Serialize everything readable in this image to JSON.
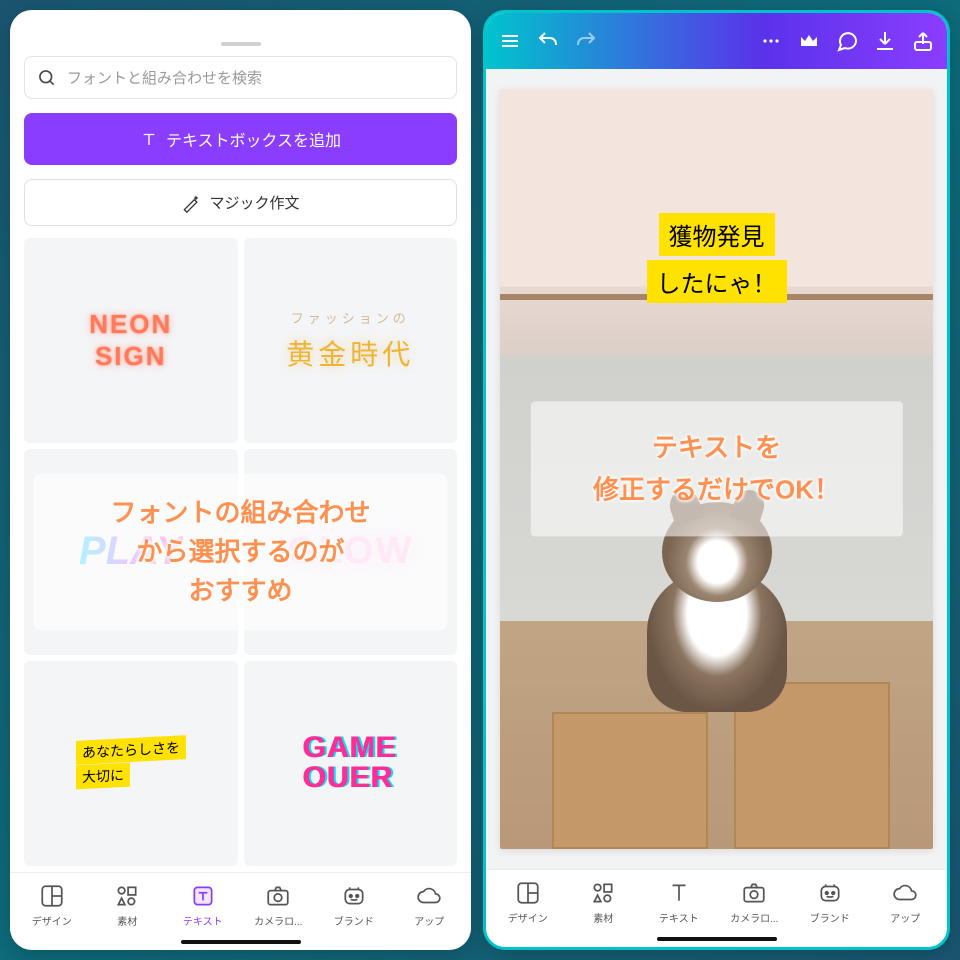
{
  "left": {
    "search_placeholder": "フォントと組み合わせを検索",
    "add_textbox": "テキストボックスを追加",
    "magic_write": "マジック作文",
    "tiles": {
      "neon_l1": "NEON",
      "neon_l2": "SIGN",
      "golden_sub": "ファッションの",
      "golden_main": "黄金時代",
      "play": "PLAY",
      "glow": "GLOW",
      "yourself_l1": "あなたらしさを",
      "yourself_l2": "大切に",
      "gameover_l1": "GAME",
      "gameover_l2": "OUER"
    },
    "overlay_l1": "フォントの組み合わせ",
    "overlay_l2": "から選択するのが",
    "overlay_l3": "おすすめ"
  },
  "right": {
    "photo_text_l1": "獲物発見",
    "photo_text_l2": "したにゃ！",
    "overlay_l1": "テキストを",
    "overlay_l2": "修正するだけでOK！"
  },
  "nav": {
    "design": "デザイン",
    "elements": "素材",
    "text": "テキスト",
    "camera": "カメラロ...",
    "brand": "ブランド",
    "upload": "アップ"
  }
}
